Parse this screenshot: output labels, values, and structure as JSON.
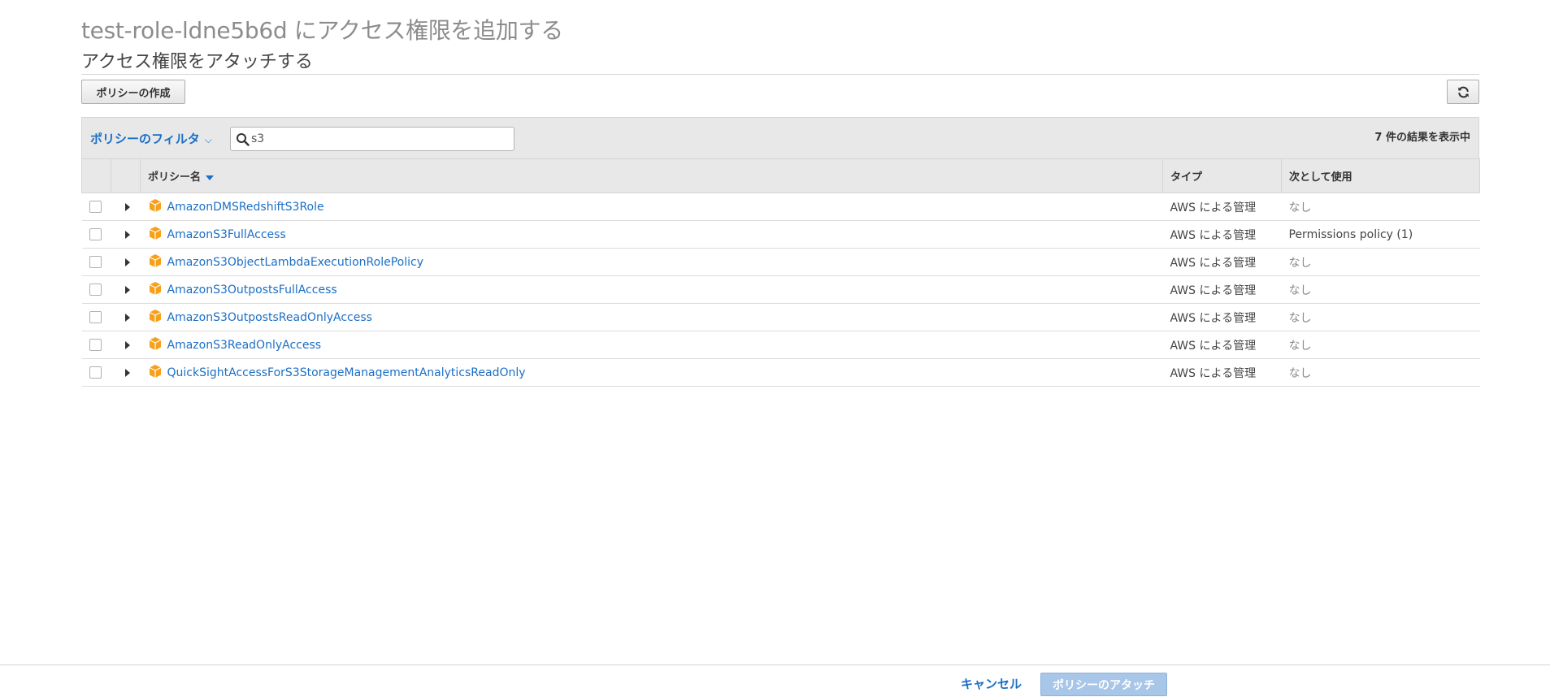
{
  "header": {
    "title": "test-role-ldne5b6d にアクセス権限を追加する",
    "subtitle": "アクセス権限をアタッチする"
  },
  "toolbar": {
    "create_policy_label": "ポリシーの作成",
    "refresh_icon": "refresh-icon"
  },
  "filter": {
    "dropdown_label": "ポリシーのフィルタ",
    "search_value": "s3",
    "result_count": "7 件の結果を表示中"
  },
  "table": {
    "columns": [
      "ポリシー名",
      "タイプ",
      "次として使用"
    ],
    "rows": [
      {
        "name": "AmazonDMSRedshiftS3Role",
        "type": "AWS による管理",
        "used_as": "なし"
      },
      {
        "name": "AmazonS3FullAccess",
        "type": "AWS による管理",
        "used_as": "Permissions policy (1)"
      },
      {
        "name": "AmazonS3ObjectLambdaExecutionRolePolicy",
        "type": "AWS による管理",
        "used_as": "なし"
      },
      {
        "name": "AmazonS3OutpostsFullAccess",
        "type": "AWS による管理",
        "used_as": "なし"
      },
      {
        "name": "AmazonS3OutpostsReadOnlyAccess",
        "type": "AWS による管理",
        "used_as": "なし"
      },
      {
        "name": "AmazonS3ReadOnlyAccess",
        "type": "AWS による管理",
        "used_as": "なし"
      },
      {
        "name": "QuickSightAccessForS3StorageManagementAnalyticsReadOnly",
        "type": "AWS による管理",
        "used_as": "なし"
      }
    ]
  },
  "footer": {
    "cancel_label": "キャンセル",
    "attach_label": "ポリシーのアタッチ"
  },
  "colors": {
    "link": "#1b6fc6",
    "policy_icon": "#f7a01c",
    "attach_disabled": "#a8c6e8"
  }
}
